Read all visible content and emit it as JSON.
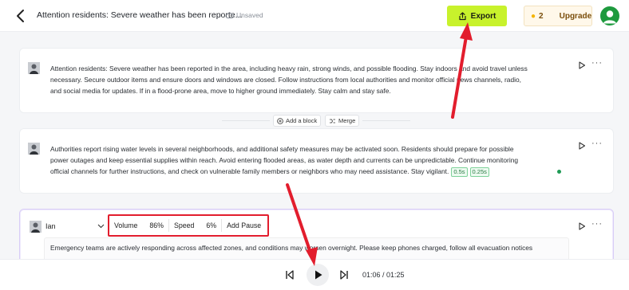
{
  "header": {
    "title": "Attention residents: Severe weather has been reporte...",
    "save_status": "Unsaved",
    "export_label": "Export",
    "credits": "2",
    "upgrade_label": "Upgrade"
  },
  "blocks": [
    {
      "lines": [
        "Attention residents: Severe weather has been reported in the area, including heavy rain, strong winds, and possible flooding. Stay indoors and avoid travel unless",
        "necessary. Secure outdoor items and ensure doors and windows are closed. Follow instructions from local authorities and monitor official news channels, radio,",
        "and social media for updates. If in a flood-prone area, move to higher ground immediately. Stay calm and stay safe."
      ]
    },
    {
      "lines": [
        "Authorities report rising water levels in several neighborhoods, and additional safety measures may be activated soon. Residents should prepare for possible",
        "power outages and keep essential supplies within reach. Avoid entering flooded areas, as water depth and currents can be unpredictable. Continue monitoring",
        "official channels for further instructions, and check on vulnerable family members or neighbors who may need assistance. Stay vigilant."
      ],
      "pauses": [
        "0.5s",
        "0.25s"
      ]
    },
    {
      "voice": "Ian",
      "volume_label": "Volume",
      "volume_value": "86%",
      "speed_label": "Speed",
      "speed_value": "6%",
      "add_pause_label": "Add Pause",
      "lines": [
        "Emergency teams are actively responding across affected zones, and conditions may worsen overnight. Please keep phones charged, follow all evacuation notices"
      ]
    }
  ],
  "between_actions": {
    "add_block": "Add a block",
    "merge": "Merge"
  },
  "player": {
    "time": "01:06 / 01:25"
  },
  "colors": {
    "export_bg": "#c8f22c",
    "annotation_red": "#e21d2d",
    "avatar_green": "#1e9a3e"
  }
}
